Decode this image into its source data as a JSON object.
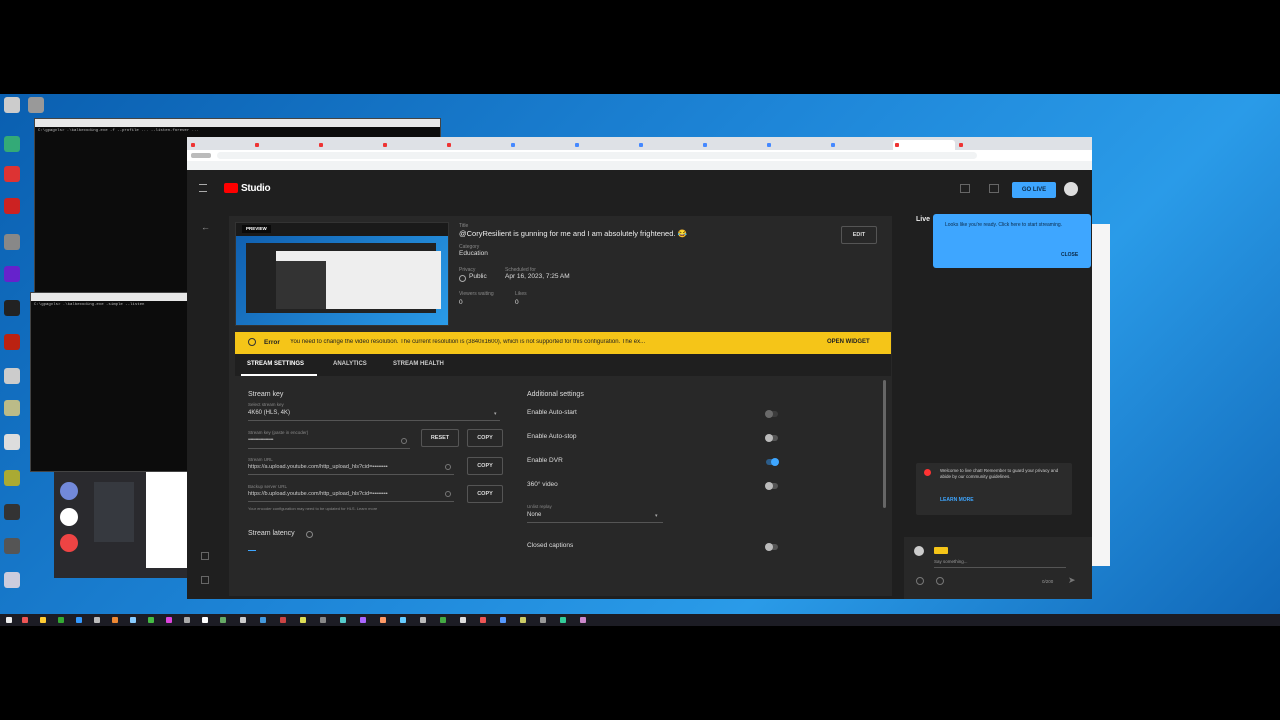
{
  "studio": {
    "logo": "Studio",
    "go_live": "GO LIVE",
    "preview_badge": "PREVIEW",
    "title_label": "Title",
    "title": "@CoryResilient is gunning for me and I am absolutely frightened. 😂",
    "category_label": "Category",
    "category": "Education",
    "privacy_label": "Privacy",
    "privacy": "Public",
    "scheduled_label": "Scheduled for",
    "scheduled": "Apr 16, 2023, 7:25 AM",
    "viewers_label": "Viewers waiting",
    "viewers": "0",
    "likes_label": "Likes",
    "likes": "0",
    "edit": "EDIT"
  },
  "error_banner": {
    "label": "Error",
    "message": "You need to change the video resolution. The current resolution is (3840x1600), which is not supported for this configuration. The ex...",
    "action": "OPEN WIDGET"
  },
  "tabs": [
    "STREAM SETTINGS",
    "ANALYTICS",
    "STREAM HEALTH"
  ],
  "stream_key": {
    "heading": "Stream key",
    "select_label": "Select stream key",
    "select_value": "4K60 (HLS, 4K)",
    "key_label": "Stream key (paste in encoder)",
    "key_value": "••••••••••••••••••••",
    "reset": "RESET",
    "copy": "COPY",
    "url_label": "Stream URL",
    "url": "https://a.upload.youtube.com/http_upload_hls?cid=••••••••",
    "backup_label": "Backup server URL",
    "backup_url": "https://b.upload.youtube.com/http_upload_hls?cid=••••••••",
    "note": "Your encoder configuration may need to be updated for HLS. Learn more",
    "latency": "Stream latency"
  },
  "additional": {
    "heading": "Additional settings",
    "auto_start": "Enable Auto-start",
    "auto_stop": "Enable Auto-stop",
    "dvr": "Enable DVR",
    "video360": "360° video",
    "unlist_label": "Unlist replay",
    "unlist_value": "None",
    "captions": "Closed captions"
  },
  "chat": {
    "live_label": "Live",
    "tooltip": "Looks like you're ready. Click here to start streaming.",
    "tooltip_close": "CLOSE",
    "welcome": "Welcome to live chat! Remember to guard your privacy and abide by our community guidelines.",
    "learn_more": "LEARN MORE",
    "say_something": "Say something...",
    "char_count": "0/200"
  },
  "colors": {
    "error_yellow": "#f5c518",
    "accent_blue": "#3ea6ff",
    "youtube_red": "#ff0000"
  }
}
